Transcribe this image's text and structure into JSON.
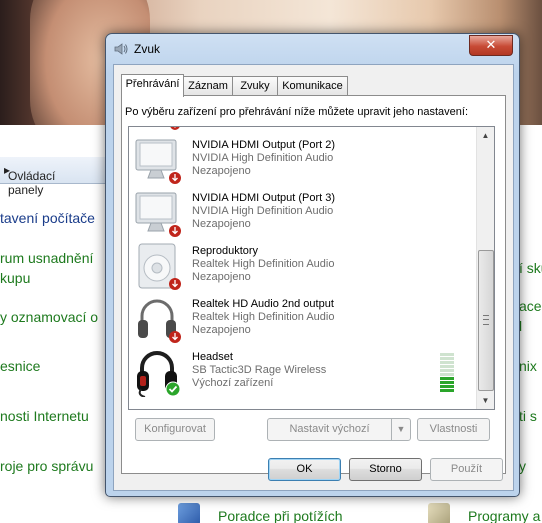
{
  "background": {
    "breadcrumb": "Ovládací panely",
    "links_left": [
      "tavení počítače",
      "rum usnadnění",
      "kupu",
      "y oznamovací o",
      "esnice",
      "nosti Internetu",
      "roje pro správu"
    ],
    "links_right": [
      "í sku",
      "ace",
      "l",
      "nix",
      "ti s",
      "y"
    ],
    "bottom_links": [
      "Poradce při potížích",
      "Programy a"
    ]
  },
  "dialog": {
    "title": "Zvuk",
    "close_label": "✕",
    "tabs": [
      {
        "label": "Přehrávání",
        "active": true
      },
      {
        "label": "Záznam",
        "active": false
      },
      {
        "label": "Zvuky",
        "active": false
      },
      {
        "label": "Komunikace",
        "active": false
      }
    ],
    "instruction": "Po výběru zařízení pro přehrávání níže můžete upravit jeho nastavení:",
    "devices": [
      {
        "name": "NVIDIA HDMI Output (Port 2)",
        "driver": "NVIDIA High Definition Audio",
        "status": "Nezapojeno",
        "icon": "monitor-icon"
      },
      {
        "name": "NVIDIA HDMI Output (Port 3)",
        "driver": "NVIDIA High Definition Audio",
        "status": "Nezapojeno",
        "icon": "monitor-icon"
      },
      {
        "name": "Reproduktory",
        "driver": "Realtek High Definition Audio",
        "status": "Nezapojeno",
        "icon": "speaker-icon"
      },
      {
        "name": "Realtek HD Audio 2nd output",
        "driver": "Realtek High Definition Audio",
        "status": "Nezapojeno",
        "icon": "headphones-icon"
      },
      {
        "name": "Headset",
        "driver": "SB Tactic3D Rage Wireless",
        "status": "Výchozí zařízení",
        "icon": "headset-icon",
        "default": true
      }
    ],
    "buttons": {
      "configure": "Konfigurovat",
      "set_default": "Nastavit výchozí",
      "properties": "Vlastnosti",
      "ok": "OK",
      "cancel": "Storno",
      "apply": "Použít"
    },
    "colors": {
      "default_check": "#2aa52a",
      "unplugged_badge": "#c0251b",
      "close_button": "#c74a35"
    }
  }
}
